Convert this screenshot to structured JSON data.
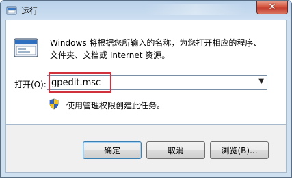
{
  "window": {
    "title": "运行",
    "close_glyph": "✕"
  },
  "icons": {
    "title_icon": "run-icon",
    "main_icon": "run-program-icon",
    "admin_icon": "uac-shield-icon"
  },
  "description": {
    "line1": "Windows 将根据您所输入的名称，为您打开相应的程序、",
    "line2": "文件夹、文档或 Internet 资源。"
  },
  "open_field": {
    "label": "打开(O):",
    "value": "gpedit.msc"
  },
  "admin_note": "使用管理权限创建此任务。",
  "buttons": {
    "ok": "确定",
    "cancel": "取消",
    "browse": "浏览(B)..."
  },
  "colors": {
    "highlight_box": "#d0313b",
    "default_button_border": "#3c7fb1"
  }
}
